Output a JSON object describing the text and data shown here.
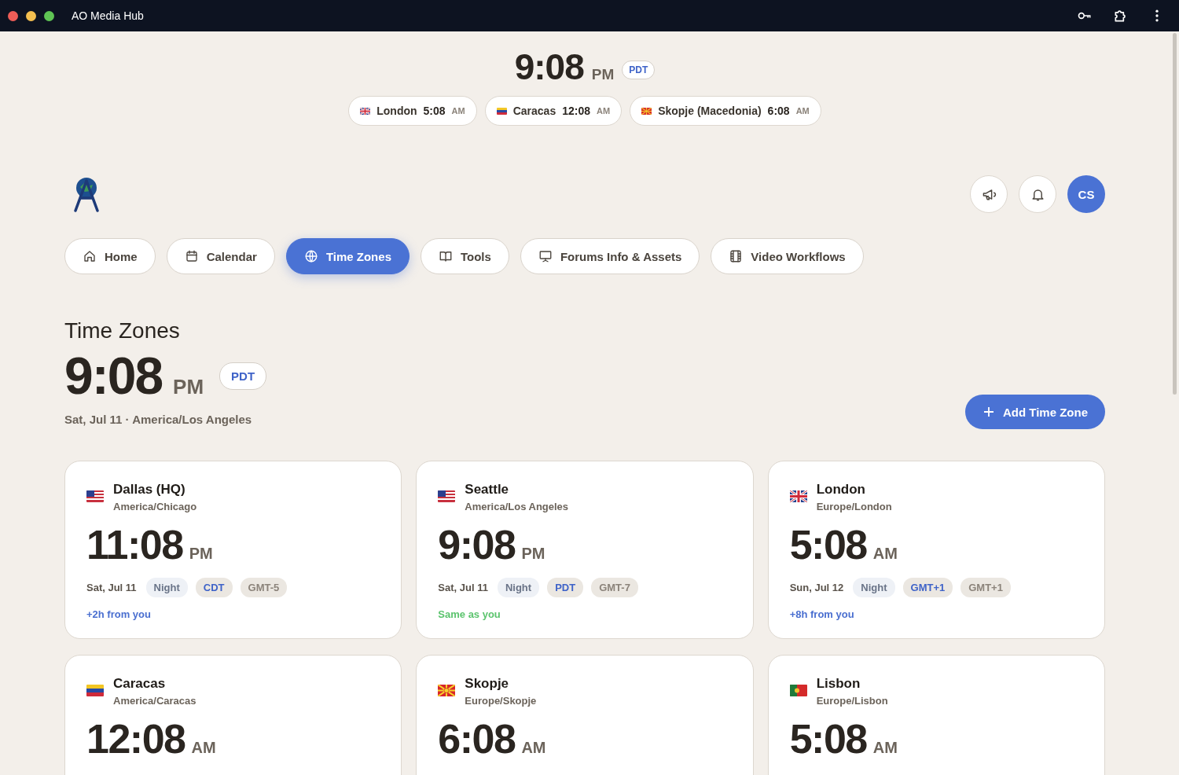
{
  "window": {
    "title": "AO Media Hub"
  },
  "top_clock": {
    "time": "9:08",
    "period": "PM",
    "zone": "PDT",
    "chips": [
      {
        "kind": "uk",
        "city": "London",
        "time": "5:08",
        "period": "AM"
      },
      {
        "kind": "ve",
        "city": "Caracas",
        "time": "12:08",
        "period": "AM"
      },
      {
        "kind": "mk",
        "city": "Skopje (Macedonia)",
        "time": "6:08",
        "period": "AM"
      }
    ]
  },
  "header": {
    "avatar": "CS"
  },
  "nav": [
    {
      "kind": "home",
      "label": "Home",
      "selected": false
    },
    {
      "kind": "calendar",
      "label": "Calendar",
      "selected": false
    },
    {
      "kind": "globe",
      "label": "Time Zones",
      "selected": true
    },
    {
      "kind": "book",
      "label": "Tools",
      "selected": false
    },
    {
      "kind": "presentation",
      "label": "Forums Info & Assets",
      "selected": false
    },
    {
      "kind": "film",
      "label": "Video Workflows",
      "selected": false
    }
  ],
  "page": {
    "title": "Time Zones",
    "time": "9:08",
    "period": "PM",
    "zone": "PDT",
    "subtitle": "Sat, Jul 11 · America/Los Angeles",
    "add_button": "Add Time Zone"
  },
  "cards": [
    {
      "kind": "us",
      "city": "Dallas (HQ)",
      "zone": "America/Chicago",
      "time": "11:08",
      "period": "PM",
      "date": "Sat, Jul 11",
      "daypart": "Night",
      "abbr": "CDT",
      "offset": "GMT-5",
      "difference": "+2h from you",
      "color": "#4a6fd0"
    },
    {
      "kind": "us",
      "city": "Seattle",
      "zone": "America/Los Angeles",
      "time": "9:08",
      "period": "PM",
      "date": "Sat, Jul 11",
      "daypart": "Night",
      "abbr": "PDT",
      "offset": "GMT-7",
      "difference": "Same as you",
      "color": "#5cc46e"
    },
    {
      "kind": "uk",
      "city": "London",
      "zone": "Europe/London",
      "time": "5:08",
      "period": "AM",
      "date": "Sun, Jul 12",
      "daypart": "Night",
      "abbr": "GMT+1",
      "offset": "GMT+1",
      "difference": "+8h from you",
      "color": "#4a6fd0"
    },
    {
      "kind": "ve",
      "city": "Caracas",
      "zone": "America/Caracas",
      "time": "12:08",
      "period": "AM"
    },
    {
      "kind": "mk",
      "city": "Skopje",
      "zone": "Europe/Skopje",
      "time": "6:08",
      "period": "AM"
    },
    {
      "kind": "pt",
      "city": "Lisbon",
      "zone": "Europe/Lisbon",
      "time": "5:08",
      "period": "AM"
    }
  ]
}
